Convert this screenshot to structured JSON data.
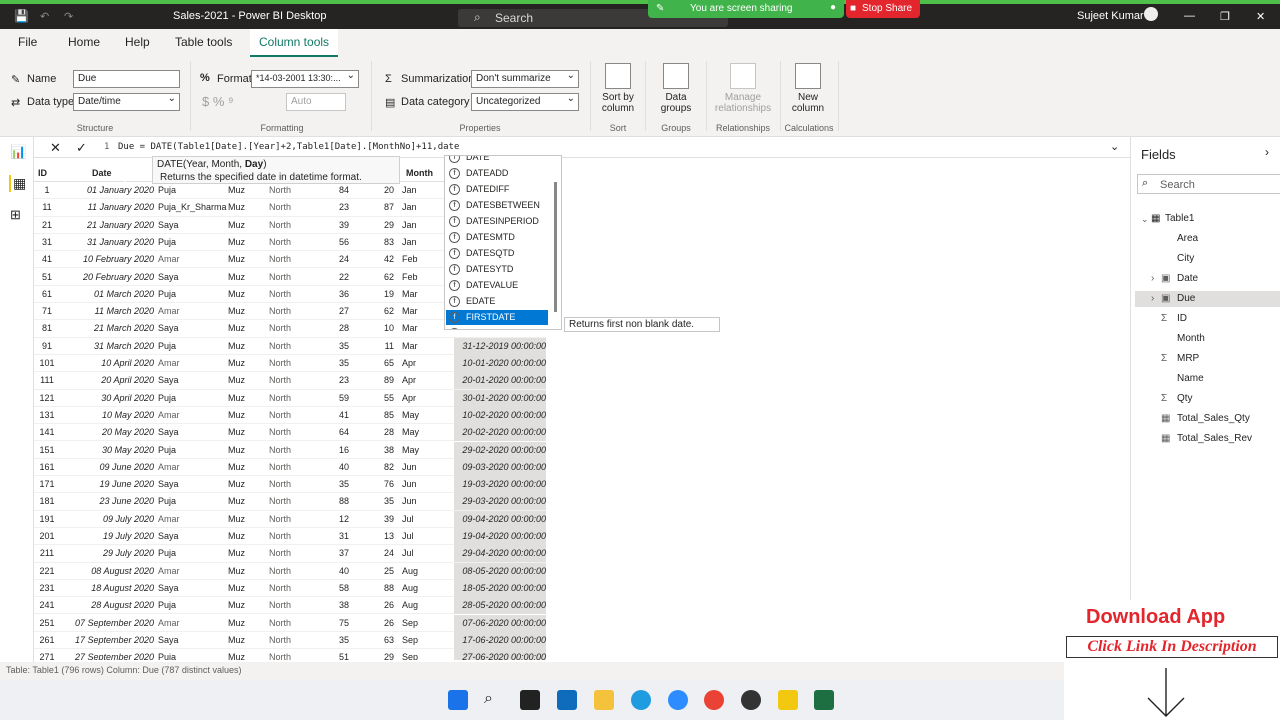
{
  "titlebar": {
    "title": "Sales-2021 - Power BI Desktop",
    "search_placeholder": "Search",
    "share_banner": "You are screen sharing",
    "stop_share": "Stop Share",
    "user": "Sujeet Kumar"
  },
  "menu": [
    "File",
    "Home",
    "Help",
    "Table tools",
    "Column tools"
  ],
  "ribbon": {
    "name_label": "Name",
    "name_value": "Due",
    "datatype_label": "Data type",
    "datatype_value": "Date/time",
    "structure_label": "Structure",
    "format_label": "Format",
    "format_value": "*14-03-2001 13:30:...",
    "currency_symbols": "$  %  ⁹",
    "auto_value": "Auto",
    "formatting_label": "Formatting",
    "summarization_label": "Summarization",
    "summarization_value": "Don't summarize",
    "datacategory_label": "Data category",
    "datacategory_value": "Uncategorized",
    "properties_label": "Properties",
    "sortby_label": "Sort by",
    "sortby_label2": "column",
    "sort_group": "Sort",
    "datagroups_label": "Data",
    "datagroups_label2": "groups",
    "groups_group": "Groups",
    "manage_label": "Manage",
    "manage_label2": "relationships",
    "relationships_group": "Relationships",
    "newcol_label": "New",
    "newcol_label2": "column",
    "calculations_group": "Calculations"
  },
  "formula": {
    "line": "1",
    "text": "Due = DATE(Table1[Date].[Year]+2,Table1[Date].[MonthNo]+11,date"
  },
  "tooltip": {
    "signature": "DATE(Year, Month, ",
    "signature_bold": "Day",
    "signature_end": ")",
    "description": "Returns the specified date in datetime format."
  },
  "autocomplete": {
    "items": [
      "DATE",
      "DATEADD",
      "DATEDIFF",
      "DATESBETWEEN",
      "DATESINPERIOD",
      "DATESMTD",
      "DATESQTD",
      "DATESYTD",
      "DATEVALUE",
      "EDATE",
      "FIRSTDATE",
      "ENDOFYEAR"
    ],
    "selected_index": 10,
    "hint": "Returns first non blank date."
  },
  "grid": {
    "headers": [
      "ID",
      "Date",
      "",
      "",
      "",
      "",
      "Month",
      ""
    ],
    "rows": [
      [
        "1",
        "01 January 2020",
        "Puja",
        "Muz",
        "North",
        "84",
        "20",
        "Jan",
        ""
      ],
      [
        "11",
        "11 January 2020",
        "Puja_Kr_Sharma",
        "Muz",
        "North",
        "23",
        "87",
        "Jan",
        ""
      ],
      [
        "21",
        "21 January 2020",
        "Saya",
        "Muz",
        "North",
        "39",
        "29",
        "Jan",
        ""
      ],
      [
        "31",
        "31 January 2020",
        "Puja",
        "Muz",
        "North",
        "56",
        "83",
        "Jan",
        ""
      ],
      [
        "41",
        "10 February 2020",
        "Amar",
        "Muz",
        "North",
        "24",
        "42",
        "Feb",
        ""
      ],
      [
        "51",
        "20 February 2020",
        "Saya",
        "Muz",
        "North",
        "22",
        "62",
        "Feb",
        ""
      ],
      [
        "61",
        "01 March 2020",
        "Puja",
        "Muz",
        "North",
        "36",
        "19",
        "Mar",
        ""
      ],
      [
        "71",
        "11 March 2020",
        "Amar",
        "Muz",
        "North",
        "27",
        "62",
        "Mar",
        ""
      ],
      [
        "81",
        "21 March 2020",
        "Saya",
        "Muz",
        "North",
        "28",
        "10",
        "Mar",
        ""
      ],
      [
        "91",
        "31 March 2020",
        "Puja",
        "Muz",
        "North",
        "35",
        "11",
        "Mar",
        "31-12-2019 00:00:00"
      ],
      [
        "101",
        "10 April 2020",
        "Amar",
        "Muz",
        "North",
        "35",
        "65",
        "Apr",
        "10-01-2020 00:00:00"
      ],
      [
        "111",
        "20 April 2020",
        "Saya",
        "Muz",
        "North",
        "23",
        "89",
        "Apr",
        "20-01-2020 00:00:00"
      ],
      [
        "121",
        "30 April 2020",
        "Puja",
        "Muz",
        "North",
        "59",
        "55",
        "Apr",
        "30-01-2020 00:00:00"
      ],
      [
        "131",
        "10 May 2020",
        "Amar",
        "Muz",
        "North",
        "41",
        "85",
        "May",
        "10-02-2020 00:00:00"
      ],
      [
        "141",
        "20 May 2020",
        "Saya",
        "Muz",
        "North",
        "64",
        "28",
        "May",
        "20-02-2020 00:00:00"
      ],
      [
        "151",
        "30 May 2020",
        "Puja",
        "Muz",
        "North",
        "16",
        "38",
        "May",
        "29-02-2020 00:00:00"
      ],
      [
        "161",
        "09 June 2020",
        "Amar",
        "Muz",
        "North",
        "40",
        "82",
        "Jun",
        "09-03-2020 00:00:00"
      ],
      [
        "171",
        "19 June 2020",
        "Saya",
        "Muz",
        "North",
        "35",
        "76",
        "Jun",
        "19-03-2020 00:00:00"
      ],
      [
        "181",
        "23 June 2020",
        "Puja",
        "Muz",
        "North",
        "88",
        "35",
        "Jun",
        "29-03-2020 00:00:00"
      ],
      [
        "191",
        "09 July 2020",
        "Amar",
        "Muz",
        "North",
        "12",
        "39",
        "Jul",
        "09-04-2020 00:00:00"
      ],
      [
        "201",
        "19 July 2020",
        "Saya",
        "Muz",
        "North",
        "31",
        "13",
        "Jul",
        "19-04-2020 00:00:00"
      ],
      [
        "211",
        "29 July 2020",
        "Puja",
        "Muz",
        "North",
        "37",
        "24",
        "Jul",
        "29-04-2020 00:00:00"
      ],
      [
        "221",
        "08 August 2020",
        "Amar",
        "Muz",
        "North",
        "40",
        "25",
        "Aug",
        "08-05-2020 00:00:00"
      ],
      [
        "231",
        "18 August 2020",
        "Saya",
        "Muz",
        "North",
        "58",
        "88",
        "Aug",
        "18-05-2020 00:00:00"
      ],
      [
        "241",
        "28 August 2020",
        "Puja",
        "Muz",
        "North",
        "38",
        "26",
        "Aug",
        "28-05-2020 00:00:00"
      ],
      [
        "251",
        "07 September 2020",
        "Amar",
        "Muz",
        "North",
        "75",
        "26",
        "Sep",
        "07-06-2020 00:00:00"
      ],
      [
        "261",
        "17 September 2020",
        "Saya",
        "Muz",
        "North",
        "35",
        "63",
        "Sep",
        "17-06-2020 00:00:00"
      ],
      [
        "271",
        "27 September 2020",
        "Puja",
        "Muz",
        "North",
        "51",
        "29",
        "Sep",
        "27-06-2020 00:00:00"
      ]
    ]
  },
  "fields": {
    "title": "Fields",
    "search_placeholder": "Search",
    "table": "Table1",
    "items": [
      [
        "",
        "Area"
      ],
      [
        "",
        "City"
      ],
      [
        "📅",
        "Date"
      ],
      [
        "📅",
        "Due"
      ],
      [
        "Σ",
        "ID"
      ],
      [
        "",
        "Month"
      ],
      [
        "Σ",
        "MRP"
      ],
      [
        "",
        "Name"
      ],
      [
        "Σ",
        "Qty"
      ],
      [
        "▦",
        "Total_Sales_Qty"
      ],
      [
        "▦",
        "Total_Sales_Rev"
      ]
    ]
  },
  "status": "Table: Table1 (796 rows) Column: Due (787 distinct values)",
  "promo": {
    "download": "Download App",
    "click": "Click Link In Description"
  }
}
